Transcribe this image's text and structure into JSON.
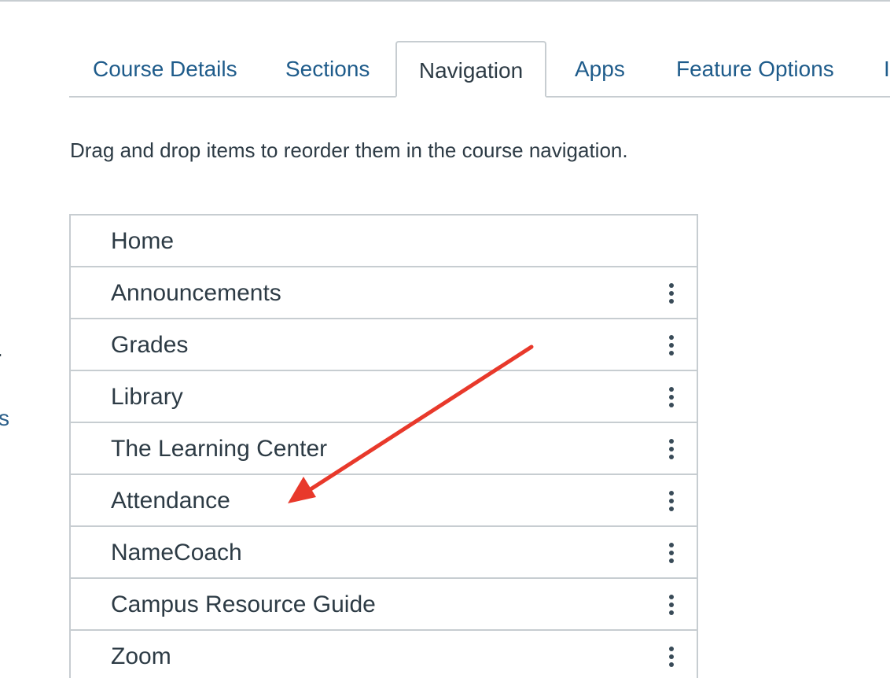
{
  "sidebar_fragments": {
    "dot": ".",
    "s_link": "s"
  },
  "tabs": [
    {
      "label": "Course Details",
      "active": false
    },
    {
      "label": "Sections",
      "active": false
    },
    {
      "label": "Navigation",
      "active": true
    },
    {
      "label": "Apps",
      "active": false
    },
    {
      "label": "Feature Options",
      "active": false
    },
    {
      "label": "I",
      "active": false
    }
  ],
  "instructions": "Drag and drop items to reorder them in the course navigation.",
  "nav_items": [
    {
      "label": "Home",
      "has_menu": false
    },
    {
      "label": "Announcements",
      "has_menu": true
    },
    {
      "label": "Grades",
      "has_menu": true
    },
    {
      "label": "Library",
      "has_menu": true
    },
    {
      "label": "The Learning Center",
      "has_menu": true
    },
    {
      "label": "Attendance",
      "has_menu": true
    },
    {
      "label": "NameCoach",
      "has_menu": true
    },
    {
      "label": "Campus Resource Guide",
      "has_menu": true
    },
    {
      "label": "Zoom",
      "has_menu": true
    }
  ],
  "annotation": {
    "type": "arrow",
    "color": "#e8392b",
    "points_to": "Attendance"
  },
  "icons": {
    "item_menu": "kebab-menu-icon"
  },
  "colors": {
    "link": "#1f5c8b",
    "text": "#2d3b45",
    "border": "#c7cdd1",
    "annotation": "#e8392b"
  }
}
